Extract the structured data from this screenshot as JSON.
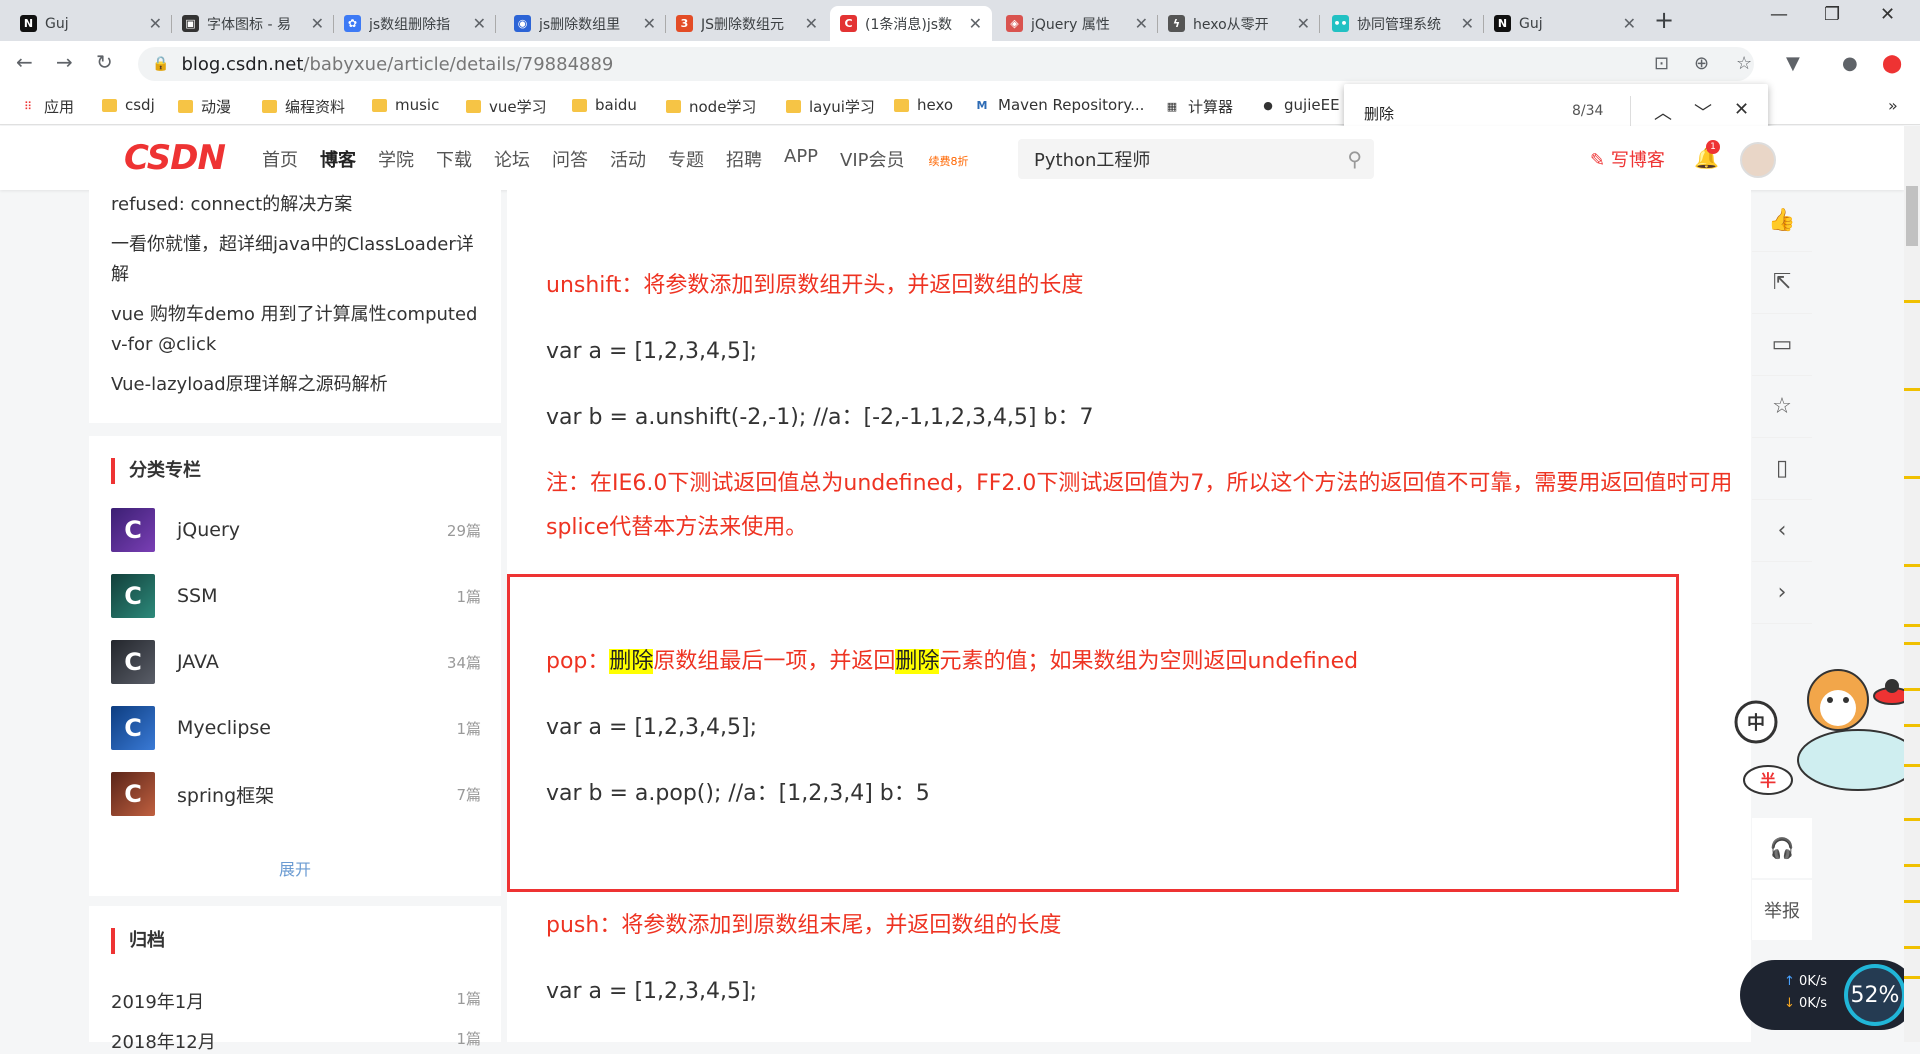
{
  "browser": {
    "tabs": [
      {
        "label": "Guj",
        "fav_text": "N",
        "fav_color": "#111111"
      },
      {
        "label": "字体图标 - 易",
        "fav_text": "▣",
        "fav_color": "#333333"
      },
      {
        "label": "js数组删除指",
        "fav_text": "✿",
        "fav_color": "#3d7af5"
      },
      {
        "label": "js删除数组里",
        "fav_text": "◉",
        "fav_color": "#2c64d6"
      },
      {
        "label": "JS删除数组元",
        "fav_text": "3",
        "fav_color": "#e34c26"
      },
      {
        "label": "(1条消息)js数",
        "fav_text": "C",
        "fav_color": "#e33333"
      },
      {
        "label": "jQuery 属性",
        "fav_text": "◈",
        "fav_color": "#d9534f"
      },
      {
        "label": "hexo从零开",
        "fav_text": "ϟ",
        "fav_color": "#555555"
      },
      {
        "label": "协同管理系统",
        "fav_text": "••",
        "fav_color": "#22c1c3"
      },
      {
        "label": "Guj",
        "fav_text": "N",
        "fav_color": "#111111"
      }
    ],
    "active_tab": 5,
    "url_host": "blog.csdn.net",
    "url_path": "/babyxue/article/details/79884889",
    "bookmarks": [
      {
        "label": "应用",
        "type": "apps"
      },
      {
        "label": "csdj",
        "type": "folder"
      },
      {
        "label": "动漫",
        "type": "folder"
      },
      {
        "label": "编程资料",
        "type": "folder"
      },
      {
        "label": "music",
        "type": "folder"
      },
      {
        "label": "vue学习",
        "type": "folder"
      },
      {
        "label": "baidu",
        "type": "folder"
      },
      {
        "label": "node学习",
        "type": "folder"
      },
      {
        "label": "layui学习",
        "type": "folder"
      },
      {
        "label": "hexo",
        "type": "folder"
      },
      {
        "label": "Maven Repository...",
        "type": "site"
      },
      {
        "label": "计算器",
        "type": "site"
      },
      {
        "label": "gujieEE",
        "type": "site"
      }
    ],
    "find": {
      "query": "删除",
      "count": "8/34"
    }
  },
  "header": {
    "logo": "CSDN",
    "nav": [
      "首页",
      "博客",
      "学院",
      "下载",
      "论坛",
      "问答",
      "活动",
      "专题",
      "招聘",
      "APP",
      "VIP会员"
    ],
    "nav_active": "博客",
    "vip_tag": "续费8折",
    "search_value": "Python工程师",
    "write_label": "写博客",
    "notif_count": "1"
  },
  "sidebar": {
    "articles": [
      "refused: connect的解决方案",
      "一看你就懂，超详细java中的ClassLoader详解",
      "vue 购物车demo 用到了计算属性computed v-for @click",
      "Vue-lazyload原理详解之源码解析"
    ],
    "categories_title": "分类专栏",
    "categories": [
      {
        "name": "jQuery",
        "count": "29篇",
        "color": "#5a2d8a"
      },
      {
        "name": "SSM",
        "count": "1篇",
        "color": "#1f6b5e"
      },
      {
        "name": "JAVA",
        "count": "34篇",
        "color": "#3a3d45"
      },
      {
        "name": "Myeclipse",
        "count": "1篇",
        "color": "#1c57a8"
      },
      {
        "name": "spring框架",
        "count": "7篇",
        "color": "#8a3a2a"
      }
    ],
    "expand_label": "展开",
    "archive_title": "归档",
    "archive": [
      {
        "name": "2019年1月",
        "count": "1篇"
      },
      {
        "name": "2018年12月",
        "count": "1篇"
      }
    ]
  },
  "article": {
    "unshift_title": "unshift：将参数添加到原数组开头，并返回数组的长度",
    "unshift_code1": "var a = [1,2,3,4,5];",
    "unshift_code2": "var b = a.unshift(-2,-1); //a：[-2,-1,1,2,3,4,5] b：7",
    "note_line1": "注：在IE6.0下测试返回值总为undefined，FF2.0下测试返回值为7，所以这个方法的返回值不可靠，需要用返回值时可用",
    "note_line2": "splice代替本方法来使用。",
    "pop_pre": "pop：",
    "pop_hl1": "删除",
    "pop_mid": "原数组最后一项，并返回",
    "pop_hl2": "删除",
    "pop_post": "元素的值；如果数组为空则返回undefined",
    "pop_code1": "var a = [1,2,3,4,5];",
    "pop_code2": "var b = a.pop(); //a：[1,2,3,4] b：5",
    "push_title": "push：将参数添加到原数组末尾，并返回数组的长度",
    "push_code1": "var a = [1,2,3,4,5];"
  },
  "right_toolbar": {
    "report_label": "举报"
  },
  "mascot": {
    "badge_top": "中",
    "badge_bottom": "半"
  },
  "net_meter": {
    "up": "0K/s",
    "down": "0K/s",
    "percent": "52%"
  }
}
